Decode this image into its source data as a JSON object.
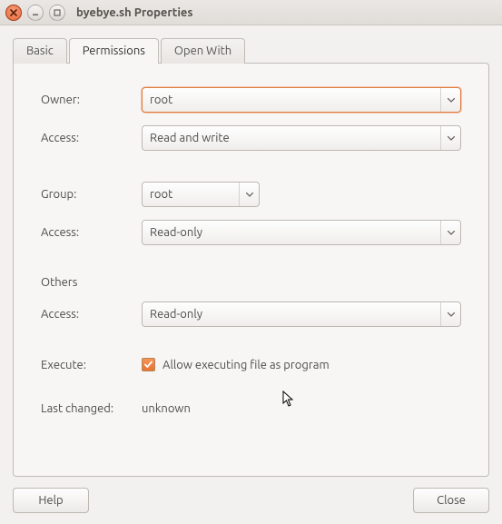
{
  "window": {
    "title": "byebye.sh Properties"
  },
  "tabs": {
    "basic": "Basic",
    "permissions": "Permissions",
    "openwith": "Open With"
  },
  "form": {
    "owner_label": "Owner:",
    "owner_value": "root",
    "owner_access_label": "Access:",
    "owner_access_value": "Read and write",
    "group_label": "Group:",
    "group_value": "root",
    "group_access_label": "Access:",
    "group_access_value": "Read-only",
    "others_label": "Others",
    "others_access_label": "Access:",
    "others_access_value": "Read-only",
    "execute_label": "Execute:",
    "execute_checkbox_label": "Allow executing file as program",
    "execute_checked": true,
    "lastchanged_label": "Last changed:",
    "lastchanged_value": "unknown"
  },
  "buttons": {
    "help": "Help",
    "close": "Close"
  }
}
